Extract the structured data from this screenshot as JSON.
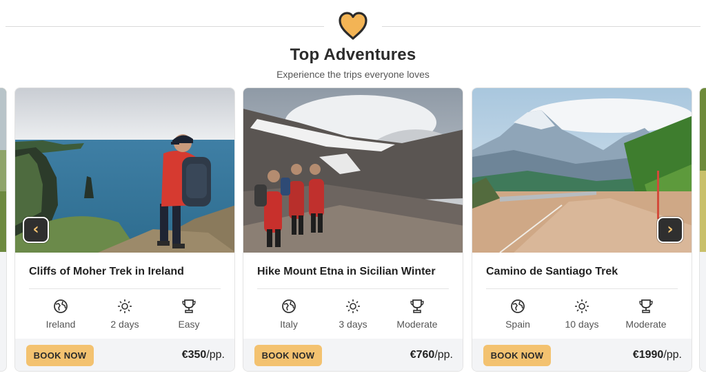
{
  "section": {
    "title": "Top Adventures",
    "subtitle": "Experience the trips everyone loves",
    "accent_color": "#f3c270",
    "icon": "heart-icon"
  },
  "carousel": {
    "prev_label": "‹",
    "next_label": "›",
    "cards": [
      {
        "title": "Cliffs of Moher Trek in Ireland",
        "photo": "cliffs-hiker-photo",
        "country": "Ireland",
        "duration": "2 days",
        "difficulty": "Easy",
        "cta": "BOOK NOW",
        "price": "€350",
        "price_unit": "/pp."
      },
      {
        "title": "Hike Mount Etna in Sicilian Winter",
        "photo": "volcano-hikers-photo",
        "country": "Italy",
        "duration": "3 days",
        "difficulty": "Moderate",
        "cta": "BOOK NOW",
        "price": "€760",
        "price_unit": "/pp."
      },
      {
        "title": "Camino de Santiago Trek",
        "photo": "mountain-road-photo",
        "country": "Spain",
        "duration": "10 days",
        "difficulty": "Moderate",
        "cta": "BOOK NOW",
        "price": "€1990",
        "price_unit": "/pp."
      }
    ]
  }
}
